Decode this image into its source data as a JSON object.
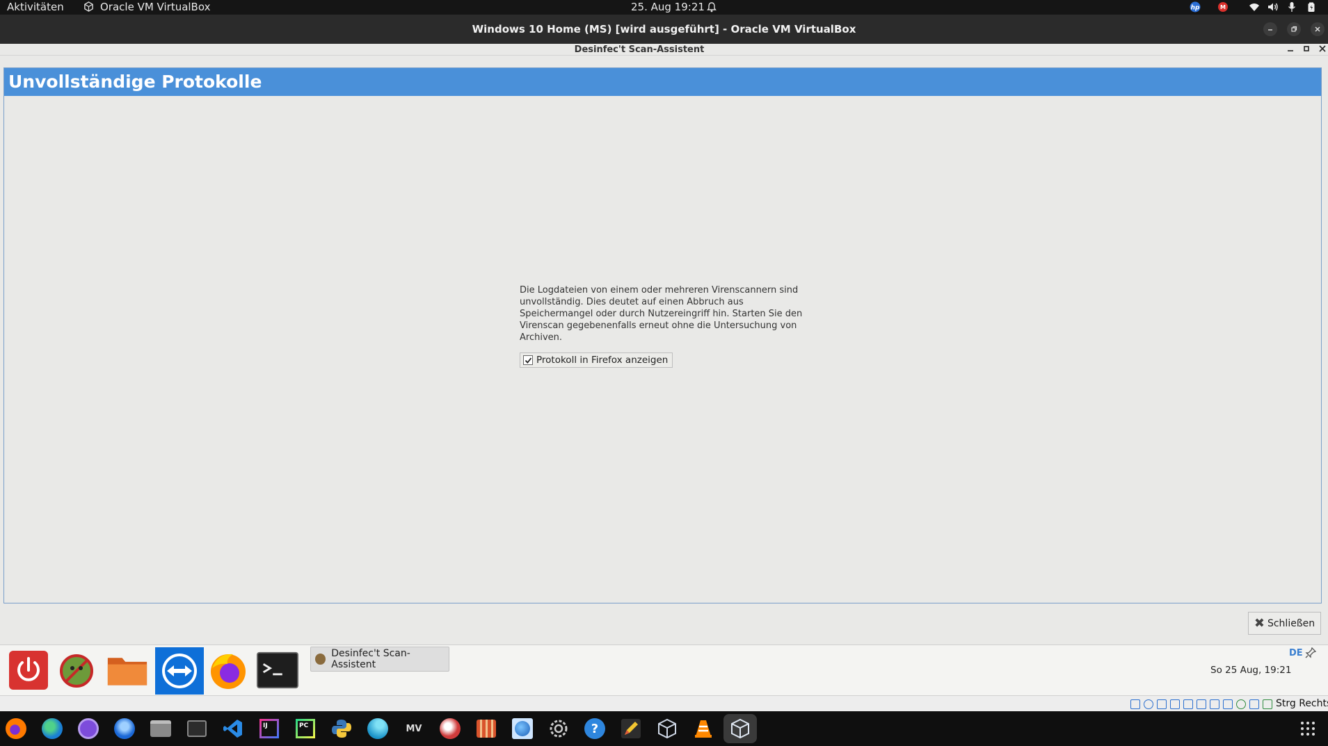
{
  "topbar": {
    "activities": "Aktivitäten",
    "app_name": "Oracle VM VirtualBox",
    "datetime": "25. Aug  19:21"
  },
  "vbox_window": {
    "title": "Windows 10 Home (MS) [wird ausgeführt] - Oracle VM VirtualBox"
  },
  "dialog": {
    "window_title": "Desinfec't Scan-Assistent",
    "heading": "Unvollständige Protokolle",
    "message": "Die Logdateien von einem oder mehreren Virenscannern sind unvollständig. Dies deutet auf einen Abbruch aus Speichermangel oder durch Nutzereingriff hin. Starten Sie den Virenscan gegebenenfalls erneut ohne die Untersuchung von Archiven.",
    "checkbox_label": "Protokoll in Firefox anzeigen",
    "checkbox_checked": true,
    "close_label": "Schließen"
  },
  "guest_panel": {
    "task_label": "Desinfec't Scan-Assistent",
    "keyboard_layout": "DE",
    "clock": "So 25 Aug, 19:21",
    "launchers": [
      "power-icon",
      "desinfect-icon",
      "folder-icon",
      "teamviewer-icon",
      "firefox-icon",
      "terminal-icon"
    ]
  },
  "vbox_statusbar": {
    "host_key": "Strg Rechts"
  },
  "dock": {
    "apps": [
      "firefox-icon",
      "edge-icon",
      "tor-icon",
      "thunderbird-icon",
      "files-icon",
      "terminal-icon",
      "vscode-icon",
      "intellij-icon",
      "pycharm-icon",
      "python-icon",
      "browser-icon",
      "clapper-icon",
      "dove-icon",
      "cake-icon",
      "globe-icon",
      "settings-icon",
      "help-icon",
      "pencil-icon",
      "virtualbox-icon",
      "vlc-icon",
      "virtualbox-running-icon"
    ]
  },
  "colors": {
    "header_blue": "#4a90d9",
    "guest_bg": "#e9e9e7",
    "topbar_bg": "#151515"
  }
}
